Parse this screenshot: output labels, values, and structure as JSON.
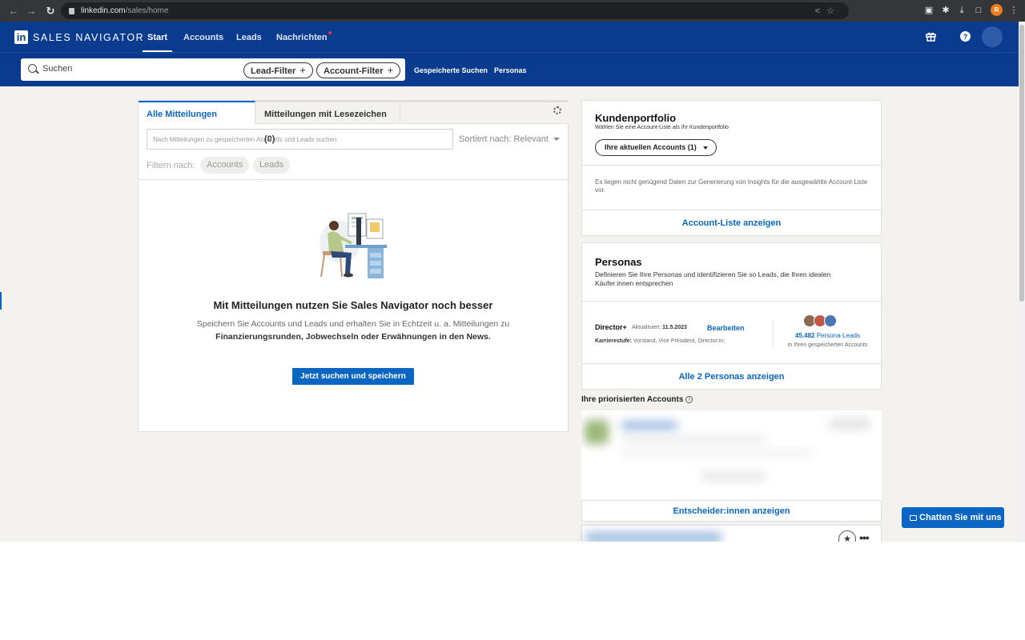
{
  "browser": {
    "url_host": "linkedin.com",
    "url_path": "/sales/home",
    "profile_initial": "R"
  },
  "nav": {
    "brand": "SALES NAVIGATOR",
    "tabs": [
      "Start",
      "Accounts",
      "Leads",
      "Nachrichten"
    ],
    "active_tab": "Start"
  },
  "search": {
    "placeholder": "Suchen",
    "lead_filter": "Lead-Filter",
    "account_filter": "Account-Filter",
    "saved_searches": "Gespeicherte Suchen",
    "personas": "Personas"
  },
  "feed": {
    "tab_all": "Alle Mitteilungen",
    "tab_bookmarked": "Mitteilungen mit Lesezeichen (0)",
    "search_placeholder": "Nach Mitteilungen zu gespeicherten Accounts und Leads suchen",
    "sort_label": "Sortiert nach: Relevant",
    "filter_label": "Filtern nach:",
    "filter_chips": [
      "Accounts",
      "Leads"
    ],
    "empty_title": "Mit Mitteilungen nutzen Sie Sales Navigator noch besser",
    "empty_text_1": "Speichern Sie Accounts und Leads und erhalten Sie in Echtzeit u. a. Mitteilungen zu",
    "empty_text_2": "Finanzierungsrunden, Jobwechseln oder Erwähnungen in den News.",
    "cta": "Jetzt suchen und speichern"
  },
  "portfolio": {
    "title": "Kundenportfolio",
    "subtitle": "Wählen Sie eine Account-Liste als Ihr Kundenportfolio",
    "dropdown": "Ihre aktuellen Accounts (1)",
    "message": "Es liegen nicht genügend Daten zur Generierung von Insights für die ausgewählte Account-Liste vor.",
    "link": "Account-Liste anzeigen"
  },
  "personas": {
    "title": "Personas",
    "description": "Definieren Sie Ihre Personas und identifizieren Sie so Leads, die Ihren idealen Käufer:innen entsprechen",
    "persona_name": "Director+",
    "updated_label": "Aktualisiert:",
    "updated_date": "11.5.2023",
    "edit": "Bearbeiten",
    "career_label": "Karrierestufe:",
    "career_value": "Vorstand, Vice President, Director:in;",
    "lead_count": "45.482",
    "lead_count_label": "Persona-Leads",
    "lead_scope": "In Ihren gespeicherten Accounts",
    "link": "Alle 2 Personas anzeigen"
  },
  "prioritized": {
    "title": "Ihre priorisierten Accounts",
    "footer_link": "Entscheider:innen anzeigen"
  },
  "chat": {
    "label": "Chatten Sie mit uns"
  },
  "colors": {
    "nav_bg": "#0a3b8f",
    "accent": "#0a66c2",
    "page_bg": "#f3f2ef"
  }
}
